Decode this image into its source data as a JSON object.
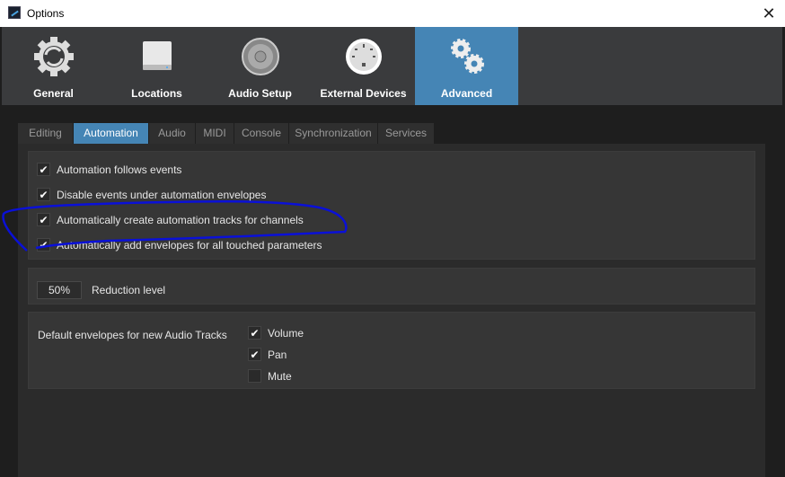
{
  "window": {
    "title": "Options",
    "close_icon": "close-icon"
  },
  "toolbar": [
    {
      "label": "General",
      "icon": "gear-refresh-icon"
    },
    {
      "label": "Locations",
      "icon": "drive-icon"
    },
    {
      "label": "Audio Setup",
      "icon": "speaker-icon"
    },
    {
      "label": "External Devices",
      "icon": "midi-port-icon"
    },
    {
      "label": "Advanced",
      "icon": "gears-icon",
      "active": true
    }
  ],
  "tabs": [
    {
      "label": "Editing"
    },
    {
      "label": "Automation",
      "active": true
    },
    {
      "label": "Audio"
    },
    {
      "label": "MIDI"
    },
    {
      "label": "Console"
    },
    {
      "label": "Synchronization"
    },
    {
      "label": "Services"
    }
  ],
  "options": [
    {
      "label": "Automation follows events",
      "checked": true
    },
    {
      "label": "Disable events under automation envelopes",
      "checked": true
    },
    {
      "label": "Automatically create automation tracks for channels",
      "checked": true
    },
    {
      "label": "Automatically add envelopes for all touched parameters",
      "checked": true
    }
  ],
  "reduction": {
    "value": "50%",
    "label": "Reduction level"
  },
  "envelopes": {
    "label": "Default envelopes for new Audio Tracks",
    "items": [
      {
        "label": "Volume",
        "checked": true
      },
      {
        "label": "Pan",
        "checked": true
      },
      {
        "label": "Mute",
        "checked": false
      }
    ]
  },
  "colors": {
    "accent": "#4585b5",
    "annotation": "#0a10d8"
  }
}
